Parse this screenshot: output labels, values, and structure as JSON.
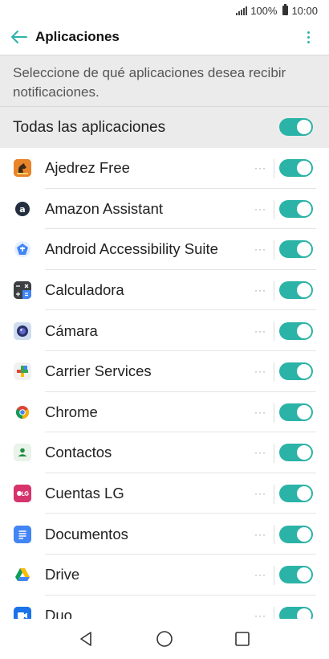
{
  "status": {
    "battery": "100%",
    "time": "10:00"
  },
  "header": {
    "title": "Aplicaciones"
  },
  "description": "Seleccione de qué aplicaciones desea recibir notificaciones.",
  "all_apps": {
    "label": "Todas las aplicaciones",
    "enabled": true
  },
  "apps": [
    {
      "name": "Ajedrez Free",
      "icon": "chess-icon",
      "enabled": true
    },
    {
      "name": "Amazon Assistant",
      "icon": "amazon-icon",
      "enabled": true
    },
    {
      "name": "Android Accessibility Suite",
      "icon": "accessibility-icon",
      "enabled": true
    },
    {
      "name": "Calculadora",
      "icon": "calculator-icon",
      "enabled": true
    },
    {
      "name": "Cámara",
      "icon": "camera-icon",
      "enabled": true
    },
    {
      "name": "Carrier Services",
      "icon": "carrier-services-icon",
      "enabled": true
    },
    {
      "name": "Chrome",
      "icon": "chrome-icon",
      "enabled": true
    },
    {
      "name": "Contactos",
      "icon": "contacts-icon",
      "enabled": true
    },
    {
      "name": "Cuentas LG",
      "icon": "lg-account-icon",
      "enabled": true
    },
    {
      "name": "Documentos",
      "icon": "docs-icon",
      "enabled": true
    },
    {
      "name": "Drive",
      "icon": "drive-icon",
      "enabled": true
    },
    {
      "name": "Duo",
      "icon": "duo-icon",
      "enabled": true
    }
  ],
  "more_glyph": "···",
  "colors": {
    "accent": "#2bb3a7",
    "section_bg": "#ebebeb"
  }
}
